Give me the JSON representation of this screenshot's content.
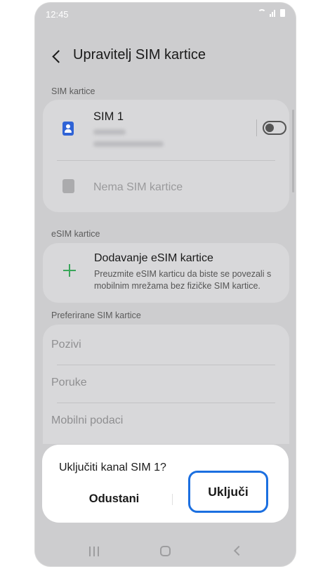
{
  "status_bar": {
    "time": "12:45"
  },
  "header": {
    "title": "Upravitelj SIM kartice"
  },
  "sim_section": {
    "label": "SIM kartice",
    "sim1": {
      "name": "SIM 1",
      "enabled": false
    },
    "no_sim": {
      "label": "Nema SIM kartice"
    }
  },
  "esim_section": {
    "label": "eSIM kartice",
    "add": {
      "title": "Dodavanje eSIM kartice",
      "description": "Preuzmite eSIM karticu da biste se povezali s mobilnim mrežama bez fizičke SIM kartice."
    }
  },
  "preferred_section": {
    "label": "Preferirane SIM kartice",
    "items": [
      "Pozivi",
      "Poruke",
      "Mobilni podaci"
    ]
  },
  "dialog": {
    "title": "Uključiti kanal SIM 1?",
    "cancel_label": "Odustani",
    "confirm_label": "Uključi",
    "accent_color": "#1b6fe0"
  },
  "icons": {
    "back": "chevron-left-icon",
    "sim": "sim-card-icon",
    "add": "plus-icon",
    "nav_recent": "recent-apps-icon",
    "nav_home": "home-icon",
    "nav_back": "back-icon"
  },
  "colors": {
    "sim_icon": "#2f63d6",
    "plus_icon": "#3aa65a",
    "dim_overlay_bg": "#cdcdcf",
    "card_bg": "#d8d8da"
  }
}
